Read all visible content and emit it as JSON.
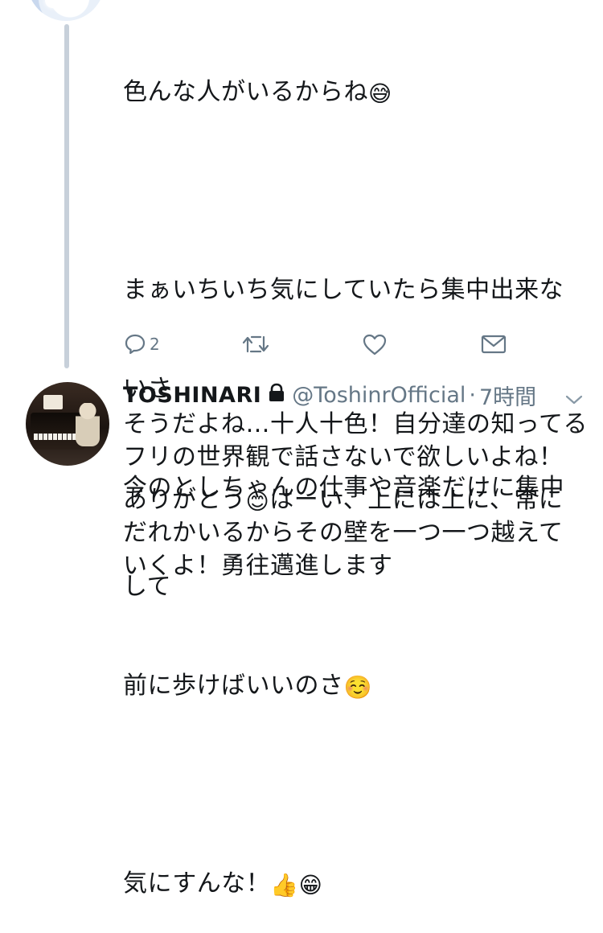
{
  "tweet_main": {
    "lines": [
      "色んな人がいるからね",
      "",
      "まぁいちいち気にしていたら集中出来な",
      "いさ",
      "今のとしちゃんの仕事や音楽だけに集中",
      "して",
      "前に歩けばいいのさ",
      "",
      "気にすんな！"
    ],
    "emoji_line1": "😅",
    "emoji_line7": "☺️",
    "emoji_line9": "👍😁",
    "reply_count": "2"
  },
  "tweet_reply": {
    "name": "TOSHINARI",
    "handle": "@ToshinrOfficial",
    "separator": "·",
    "time": "7時間",
    "paragraph1": [
      "そうだよね…十人十色！自分達の知ってる",
      "フリの世界観で話さないで欲しいよね！"
    ],
    "paragraph2_line1_a": "ありがとう",
    "paragraph2_line1_emoji": "😊",
    "paragraph2_line1_b": "はーい、上には上に、常に",
    "paragraph2_rest": [
      "だれかいるからその壁を一つ一つ越えて",
      "いくよ！勇往邁進します"
    ]
  },
  "colors": {
    "text": "#14171a",
    "secondary": "#657786",
    "thread_line": "#c7d0da"
  },
  "icons": [
    "reply-icon",
    "retweet-icon",
    "like-icon",
    "dm-icon",
    "lock-icon",
    "chevron-down-icon"
  ]
}
